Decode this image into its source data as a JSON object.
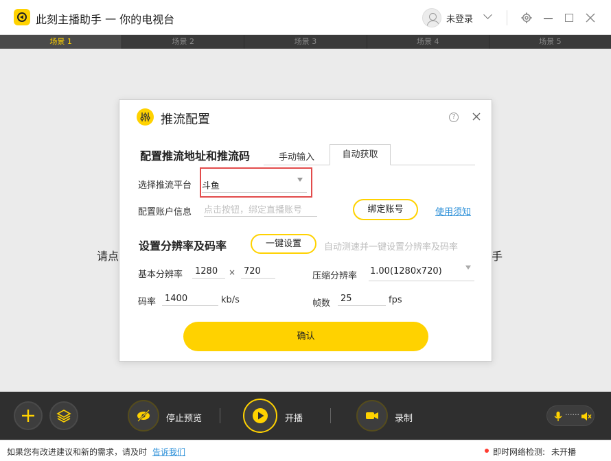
{
  "app": {
    "title": "此刻主播助手 一 你的电视台",
    "user_label": "未登录"
  },
  "scenes": [
    "场景 1",
    "场景 2",
    "场景 3",
    "场景 4",
    "场景 5"
  ],
  "main": {
    "hint_left": "请点",
    "hint_right": "手"
  },
  "dialog": {
    "title": "推流配置",
    "help_glyph": "?",
    "section_push": "配置推流地址和推流码",
    "tab_manual": "手动输入",
    "tab_auto": "自动获取",
    "platform_label": "选择推流平台",
    "platform_value": "斗鱼",
    "account_label": "配置账户信息",
    "account_placeholder": "点击按钮，绑定直播账号",
    "bind_button": "绑定账号",
    "usage_link": "使用须知",
    "section_res": "设置分辨率及码率",
    "oneclick_button": "一键设置",
    "auto_hint": "自动测速并一键设置分辨率及码率",
    "base_res_label": "基本分辨率",
    "base_width": "1280",
    "times": "×",
    "base_height": "720",
    "comp_res_label": "压缩分辨率",
    "comp_res_value": "1.00(1280x720)",
    "bitrate_label": "码率",
    "bitrate_value": "1400",
    "bitrate_unit": "kb/s",
    "fps_label": "帧数",
    "fps_value": "25",
    "fps_unit": "fps",
    "confirm_button": "确认"
  },
  "toolbar": {
    "stop_preview": "停止预览",
    "start_live": "开播",
    "record": "录制",
    "audio_dots": "······"
  },
  "status": {
    "feedback_text": "如果您有改进建议和新的需求，请及时",
    "feedback_link": "告诉我们",
    "net_label": "即时网络检测:",
    "net_value": "未开播"
  },
  "colors": {
    "accent": "#ffd200",
    "link": "#2b8fd8",
    "highlight_border": "#e24b4b",
    "status_dot": "#ff3b30"
  }
}
